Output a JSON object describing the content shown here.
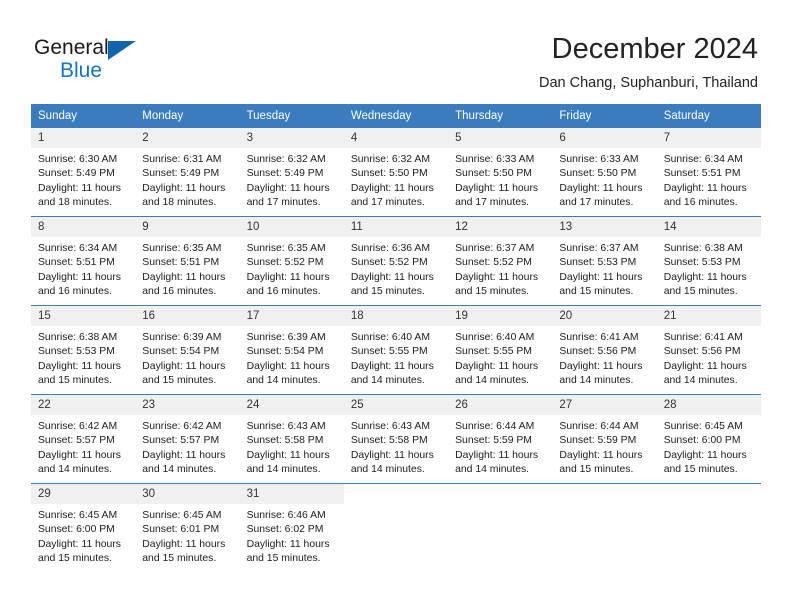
{
  "brand": {
    "name_part1": "General",
    "name_part2": "Blue",
    "logo_icon": "triangle-logo-icon",
    "accent_color": "#1574c4"
  },
  "header": {
    "month_title": "December 2024",
    "location": "Dan Chang, Suphanburi, Thailand"
  },
  "calendar": {
    "header_color": "#3a7cbe",
    "weekday_headers": [
      "Sunday",
      "Monday",
      "Tuesday",
      "Wednesday",
      "Thursday",
      "Friday",
      "Saturday"
    ],
    "weeks": [
      [
        {
          "day": "1",
          "sunrise": "Sunrise: 6:30 AM",
          "sunset": "Sunset: 5:49 PM",
          "daylight1": "Daylight: 11 hours",
          "daylight2": "and 18 minutes."
        },
        {
          "day": "2",
          "sunrise": "Sunrise: 6:31 AM",
          "sunset": "Sunset: 5:49 PM",
          "daylight1": "Daylight: 11 hours",
          "daylight2": "and 18 minutes."
        },
        {
          "day": "3",
          "sunrise": "Sunrise: 6:32 AM",
          "sunset": "Sunset: 5:49 PM",
          "daylight1": "Daylight: 11 hours",
          "daylight2": "and 17 minutes."
        },
        {
          "day": "4",
          "sunrise": "Sunrise: 6:32 AM",
          "sunset": "Sunset: 5:50 PM",
          "daylight1": "Daylight: 11 hours",
          "daylight2": "and 17 minutes."
        },
        {
          "day": "5",
          "sunrise": "Sunrise: 6:33 AM",
          "sunset": "Sunset: 5:50 PM",
          "daylight1": "Daylight: 11 hours",
          "daylight2": "and 17 minutes."
        },
        {
          "day": "6",
          "sunrise": "Sunrise: 6:33 AM",
          "sunset": "Sunset: 5:50 PM",
          "daylight1": "Daylight: 11 hours",
          "daylight2": "and 17 minutes."
        },
        {
          "day": "7",
          "sunrise": "Sunrise: 6:34 AM",
          "sunset": "Sunset: 5:51 PM",
          "daylight1": "Daylight: 11 hours",
          "daylight2": "and 16 minutes."
        }
      ],
      [
        {
          "day": "8",
          "sunrise": "Sunrise: 6:34 AM",
          "sunset": "Sunset: 5:51 PM",
          "daylight1": "Daylight: 11 hours",
          "daylight2": "and 16 minutes."
        },
        {
          "day": "9",
          "sunrise": "Sunrise: 6:35 AM",
          "sunset": "Sunset: 5:51 PM",
          "daylight1": "Daylight: 11 hours",
          "daylight2": "and 16 minutes."
        },
        {
          "day": "10",
          "sunrise": "Sunrise: 6:35 AM",
          "sunset": "Sunset: 5:52 PM",
          "daylight1": "Daylight: 11 hours",
          "daylight2": "and 16 minutes."
        },
        {
          "day": "11",
          "sunrise": "Sunrise: 6:36 AM",
          "sunset": "Sunset: 5:52 PM",
          "daylight1": "Daylight: 11 hours",
          "daylight2": "and 15 minutes."
        },
        {
          "day": "12",
          "sunrise": "Sunrise: 6:37 AM",
          "sunset": "Sunset: 5:52 PM",
          "daylight1": "Daylight: 11 hours",
          "daylight2": "and 15 minutes."
        },
        {
          "day": "13",
          "sunrise": "Sunrise: 6:37 AM",
          "sunset": "Sunset: 5:53 PM",
          "daylight1": "Daylight: 11 hours",
          "daylight2": "and 15 minutes."
        },
        {
          "day": "14",
          "sunrise": "Sunrise: 6:38 AM",
          "sunset": "Sunset: 5:53 PM",
          "daylight1": "Daylight: 11 hours",
          "daylight2": "and 15 minutes."
        }
      ],
      [
        {
          "day": "15",
          "sunrise": "Sunrise: 6:38 AM",
          "sunset": "Sunset: 5:53 PM",
          "daylight1": "Daylight: 11 hours",
          "daylight2": "and 15 minutes."
        },
        {
          "day": "16",
          "sunrise": "Sunrise: 6:39 AM",
          "sunset": "Sunset: 5:54 PM",
          "daylight1": "Daylight: 11 hours",
          "daylight2": "and 15 minutes."
        },
        {
          "day": "17",
          "sunrise": "Sunrise: 6:39 AM",
          "sunset": "Sunset: 5:54 PM",
          "daylight1": "Daylight: 11 hours",
          "daylight2": "and 14 minutes."
        },
        {
          "day": "18",
          "sunrise": "Sunrise: 6:40 AM",
          "sunset": "Sunset: 5:55 PM",
          "daylight1": "Daylight: 11 hours",
          "daylight2": "and 14 minutes."
        },
        {
          "day": "19",
          "sunrise": "Sunrise: 6:40 AM",
          "sunset": "Sunset: 5:55 PM",
          "daylight1": "Daylight: 11 hours",
          "daylight2": "and 14 minutes."
        },
        {
          "day": "20",
          "sunrise": "Sunrise: 6:41 AM",
          "sunset": "Sunset: 5:56 PM",
          "daylight1": "Daylight: 11 hours",
          "daylight2": "and 14 minutes."
        },
        {
          "day": "21",
          "sunrise": "Sunrise: 6:41 AM",
          "sunset": "Sunset: 5:56 PM",
          "daylight1": "Daylight: 11 hours",
          "daylight2": "and 14 minutes."
        }
      ],
      [
        {
          "day": "22",
          "sunrise": "Sunrise: 6:42 AM",
          "sunset": "Sunset: 5:57 PM",
          "daylight1": "Daylight: 11 hours",
          "daylight2": "and 14 minutes."
        },
        {
          "day": "23",
          "sunrise": "Sunrise: 6:42 AM",
          "sunset": "Sunset: 5:57 PM",
          "daylight1": "Daylight: 11 hours",
          "daylight2": "and 14 minutes."
        },
        {
          "day": "24",
          "sunrise": "Sunrise: 6:43 AM",
          "sunset": "Sunset: 5:58 PM",
          "daylight1": "Daylight: 11 hours",
          "daylight2": "and 14 minutes."
        },
        {
          "day": "25",
          "sunrise": "Sunrise: 6:43 AM",
          "sunset": "Sunset: 5:58 PM",
          "daylight1": "Daylight: 11 hours",
          "daylight2": "and 14 minutes."
        },
        {
          "day": "26",
          "sunrise": "Sunrise: 6:44 AM",
          "sunset": "Sunset: 5:59 PM",
          "daylight1": "Daylight: 11 hours",
          "daylight2": "and 14 minutes."
        },
        {
          "day": "27",
          "sunrise": "Sunrise: 6:44 AM",
          "sunset": "Sunset: 5:59 PM",
          "daylight1": "Daylight: 11 hours",
          "daylight2": "and 15 minutes."
        },
        {
          "day": "28",
          "sunrise": "Sunrise: 6:45 AM",
          "sunset": "Sunset: 6:00 PM",
          "daylight1": "Daylight: 11 hours",
          "daylight2": "and 15 minutes."
        }
      ],
      [
        {
          "day": "29",
          "sunrise": "Sunrise: 6:45 AM",
          "sunset": "Sunset: 6:00 PM",
          "daylight1": "Daylight: 11 hours",
          "daylight2": "and 15 minutes."
        },
        {
          "day": "30",
          "sunrise": "Sunrise: 6:45 AM",
          "sunset": "Sunset: 6:01 PM",
          "daylight1": "Daylight: 11 hours",
          "daylight2": "and 15 minutes."
        },
        {
          "day": "31",
          "sunrise": "Sunrise: 6:46 AM",
          "sunset": "Sunset: 6:02 PM",
          "daylight1": "Daylight: 11 hours",
          "daylight2": "and 15 minutes."
        },
        {
          "day": "",
          "sunrise": "",
          "sunset": "",
          "daylight1": "",
          "daylight2": ""
        },
        {
          "day": "",
          "sunrise": "",
          "sunset": "",
          "daylight1": "",
          "daylight2": ""
        },
        {
          "day": "",
          "sunrise": "",
          "sunset": "",
          "daylight1": "",
          "daylight2": ""
        },
        {
          "day": "",
          "sunrise": "",
          "sunset": "",
          "daylight1": "",
          "daylight2": ""
        }
      ]
    ]
  }
}
